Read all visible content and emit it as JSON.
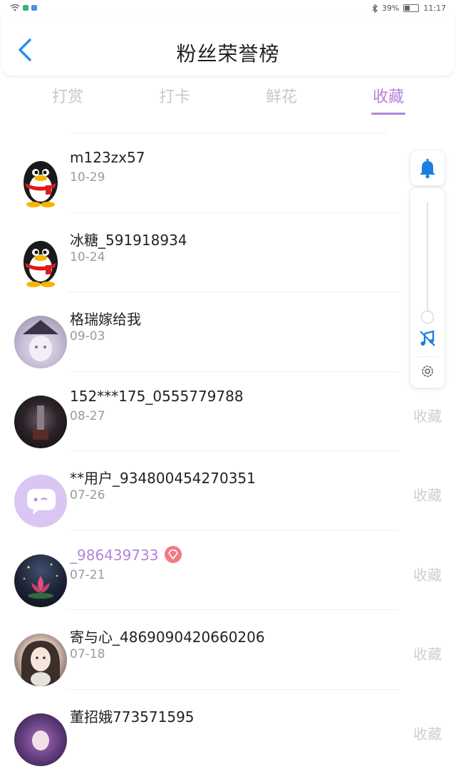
{
  "status_bar": {
    "battery": "39%",
    "battery_level": 0.39,
    "time": "11:17"
  },
  "header": {
    "title": "粉丝荣誉榜"
  },
  "tabs": [
    {
      "label": "打赏",
      "active": false
    },
    {
      "label": "打卡",
      "active": false
    },
    {
      "label": "鲜花",
      "active": false
    },
    {
      "label": "收藏",
      "active": true
    }
  ],
  "list": [
    {
      "name": "m123zx57",
      "date": "10-29",
      "action": "",
      "avatar": "qq-penguin-avatar",
      "vip": false
    },
    {
      "name": "冰糖_591918934",
      "date": "10-24",
      "action": "",
      "avatar": "qq-penguin-avatar",
      "vip": false
    },
    {
      "name": "格瑞嫁给我",
      "date": "09-03",
      "action": "",
      "avatar": "anime-witch-avatar",
      "vip": false
    },
    {
      "name": "152***175_0555779788",
      "date": "08-27",
      "action": "收藏",
      "avatar": "dark-photo-avatar",
      "vip": false
    },
    {
      "name": "**用户_934800454270351",
      "date": "07-26",
      "action": "收藏",
      "avatar": "chat-bubble-avatar",
      "vip": false
    },
    {
      "name": "_986439733",
      "date": "07-21",
      "action": "收藏",
      "avatar": "lotus-avatar",
      "vip": true
    },
    {
      "name": "寄与心_4869090420660206",
      "date": "07-18",
      "action": "收藏",
      "avatar": "girl-photo-avatar",
      "vip": false
    },
    {
      "name": "董招娥773571595",
      "date": "",
      "action": "收藏",
      "avatar": "purple-anime-avatar",
      "vip": false
    }
  ],
  "colors": {
    "accent": "#b483d8",
    "tab_inactive": "#c8c8c8",
    "action_text": "#cfcfcf",
    "icon_blue": "#1a7fe0",
    "vip_badge": "#f07a86"
  }
}
